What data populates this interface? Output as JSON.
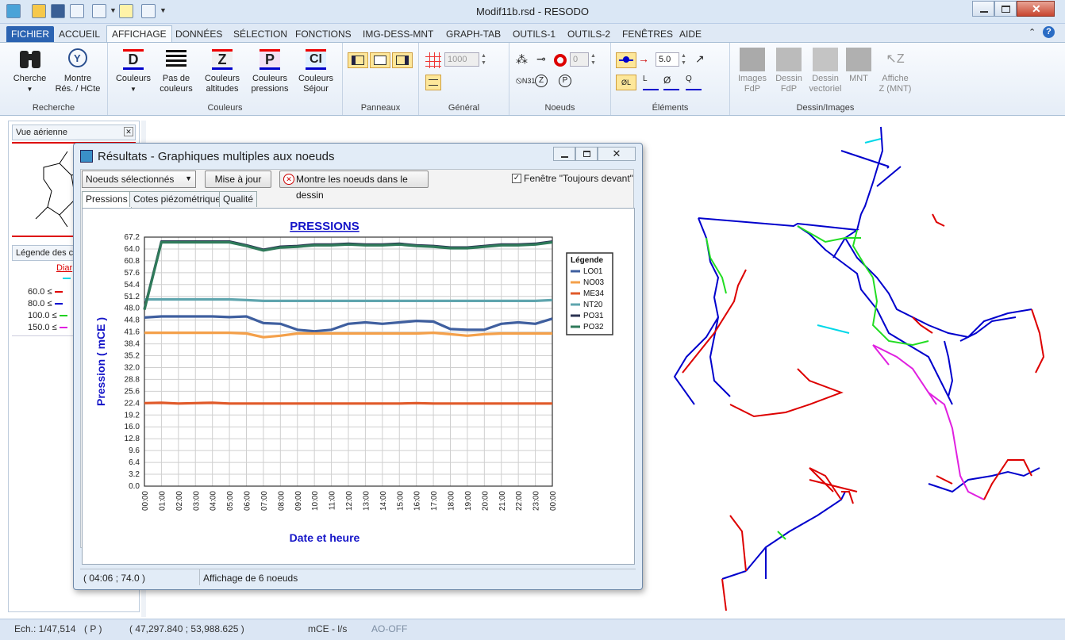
{
  "window": {
    "title": "Modif11b.rsd - RESODO"
  },
  "tabs": [
    "FICHIER",
    "ACCUEIL",
    "AFFICHAGE",
    "DONNÉES",
    "SÉLECTION",
    "FONCTIONS",
    "IMG-DESS-MNT",
    "GRAPH-TAB",
    "OUTILS-1",
    "OUTILS-2",
    "FENÊTRES",
    "AIDE"
  ],
  "ribbon": {
    "recherche": {
      "label": "Recherche",
      "cherche": "Cherche",
      "montre_line1": "Montre",
      "montre_line2": "Rés. / HCte"
    },
    "couleurs": {
      "label": "Couleurs",
      "couleurs": "Couleurs",
      "pas1": "Pas de",
      "pas2": "couleurs",
      "alt1": "Couleurs",
      "alt2": "altitudes",
      "pres1": "Couleurs",
      "pres2": "pressions",
      "sej1": "Couleurs",
      "sej2": "Séjour"
    },
    "panneaux": {
      "label": "Panneaux"
    },
    "general": {
      "label": "Général",
      "spin_value": "1000"
    },
    "noeuds": {
      "label": "Noeuds",
      "spin_value": "0",
      "n31": "N31"
    },
    "elements": {
      "label": "Éléments",
      "spin_value": "5.0"
    },
    "dessin": {
      "label": "Dessin/Images",
      "img1": "Images",
      "img2": "FdP",
      "des1": "Dessin",
      "des2": "FdP",
      "vec1": "Dessin",
      "vec2": "vectoriel",
      "mnt": "MNT",
      "aff1": "Affiche",
      "aff2": "Z (MNT)"
    }
  },
  "leftpane": {
    "aerial_title": "Vue aérienne",
    "legend_title": "Légende des c",
    "legend_sub": "Diar",
    "legend_items": [
      "60.0 ≤",
      "80.0 ≤",
      "100.0 ≤",
      "150.0 ≤"
    ],
    "legend_colors": [
      "#e00000",
      "#0000d0",
      "#20d020",
      "#e020e0"
    ]
  },
  "statusbar": {
    "scale": "Ech.: 1/47,514",
    "flag": "( P )",
    "coords": "( 47,297.840 ; 53,988.625 )",
    "units": "mCE - l/s",
    "ao": "AO-OFF"
  },
  "dialog": {
    "title": "Résultats - Graphiques multiples aux noeuds",
    "select_value": "Noeuds sélectionnés",
    "update_button": "Mise à jour",
    "show_button": "Montre les noeuds dans le dessin",
    "always_front": "Fenêtre \"Toujours devant\"",
    "tabs": [
      "Pressions",
      "Cotes piézométriques",
      "Qualité"
    ],
    "status_coords": "( 04:06 ; 74.0 )",
    "status_text": "Affichage de 6 noeuds"
  },
  "chart_data": {
    "type": "line",
    "title": "PRESSIONS",
    "xlabel": "Date et heure",
    "ylabel": "Pression ( mCE )",
    "ylim": [
      0,
      67.2
    ],
    "yticks": [
      "67.2",
      "64.0",
      "60.8",
      "57.6",
      "54.4",
      "51.2",
      "48.0",
      "44.8",
      "41.6",
      "38.4",
      "35.2",
      "32.0",
      "28.8",
      "25.6",
      "22.4",
      "19.2",
      "16.0",
      "12.8",
      "9.6",
      "6.4",
      "3.2",
      "0.0"
    ],
    "categories": [
      "00:00",
      "01:00",
      "02:00",
      "03:00",
      "04:00",
      "05:00",
      "06:00",
      "07:00",
      "08:00",
      "09:00",
      "10:00",
      "11:00",
      "12:00",
      "13:00",
      "14:00",
      "15:00",
      "16:00",
      "17:00",
      "18:00",
      "19:00",
      "20:00",
      "21:00",
      "22:00",
      "23:00",
      "00:00"
    ],
    "legend_title": "Légende",
    "series": [
      {
        "name": "LO01",
        "color": "#3f5f9f",
        "values": [
          45.5,
          45.8,
          45.8,
          45.8,
          45.8,
          45.6,
          45.8,
          44.0,
          43.8,
          42.2,
          41.8,
          42.2,
          43.8,
          44.2,
          43.8,
          44.2,
          44.6,
          44.4,
          42.4,
          42.2,
          42.2,
          43.8,
          44.2,
          43.8,
          45.2
        ]
      },
      {
        "name": "NO03",
        "color": "#f4a04a",
        "values": [
          41.4,
          41.4,
          41.4,
          41.4,
          41.4,
          41.4,
          41.2,
          40.2,
          40.6,
          41.2,
          41.2,
          41.2,
          41.2,
          41.2,
          41.2,
          41.2,
          41.2,
          41.4,
          41.0,
          40.6,
          41.0,
          41.2,
          41.2,
          41.2,
          41.2
        ]
      },
      {
        "name": "ME34",
        "color": "#e05a2a",
        "values": [
          22.4,
          22.5,
          22.3,
          22.4,
          22.5,
          22.3,
          22.3,
          22.3,
          22.3,
          22.3,
          22.3,
          22.3,
          22.3,
          22.3,
          22.3,
          22.3,
          22.4,
          22.3,
          22.3,
          22.3,
          22.3,
          22.3,
          22.3,
          22.3,
          22.3
        ]
      },
      {
        "name": "NT20",
        "color": "#5fa5ae",
        "values": [
          50.4,
          50.4,
          50.4,
          50.4,
          50.4,
          50.4,
          50.2,
          50.0,
          50.0,
          50.0,
          50.0,
          50.0,
          50.0,
          50.0,
          50.0,
          50.0,
          50.0,
          50.0,
          50.0,
          50.0,
          50.0,
          50.0,
          50.0,
          50.0,
          50.2
        ]
      },
      {
        "name": "PO31",
        "color": "#2b3352",
        "values": [
          47.8,
          66.0,
          66.0,
          66.0,
          66.0,
          66.0,
          65.0,
          63.8,
          64.6,
          64.8,
          65.2,
          65.2,
          65.4,
          65.2,
          65.2,
          65.4,
          65.0,
          64.8,
          64.4,
          64.4,
          64.8,
          65.2,
          65.2,
          65.4,
          66.0
        ]
      },
      {
        "name": "PO32",
        "color": "#2f7a5a",
        "values": [
          47.6,
          65.8,
          65.8,
          65.8,
          65.8,
          65.8,
          64.8,
          63.6,
          64.4,
          64.6,
          65.0,
          65.0,
          65.2,
          65.0,
          65.0,
          65.2,
          64.8,
          64.6,
          64.2,
          64.2,
          64.6,
          65.0,
          65.0,
          65.2,
          65.8
        ]
      }
    ]
  },
  "map": {
    "colors": {
      "blue": "#0000cc",
      "green": "#22dd22",
      "red": "#dd0000",
      "magenta": "#e020e0",
      "cyan": "#00d8e8"
    }
  }
}
